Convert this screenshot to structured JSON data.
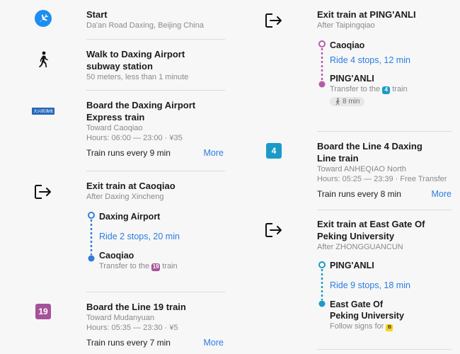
{
  "left": {
    "start": {
      "title": "Start",
      "address": "Da'an Road Daxing, Beijing China"
    },
    "walk": {
      "title_line1": "Walk to Daxing Airport",
      "title_line2": "subway station",
      "detail": "50 meters, less than 1 minute"
    },
    "board_express": {
      "badge_text": "大兴机场线",
      "title_line1": "Board the Daxing Airport",
      "title_line2": "Express train",
      "toward": "Toward Caoqiao",
      "hours": "Hours: 06:00 — 23:00 · ¥35",
      "frequency": "Train runs every 9 min",
      "more": "More"
    },
    "exit_caoqiao": {
      "title": "Exit train at Caoqiao",
      "after": "After Daxing Xincheng",
      "from_stop": "Daxing Airport",
      "ride": "Ride 2 stops, 20 min",
      "to_stop": "Caoqiao",
      "transfer_prefix": "Transfer to the",
      "transfer_badge": "19",
      "transfer_suffix": "train",
      "line_color": "#2e7fd6"
    },
    "board_19": {
      "badge_text": "19",
      "badge_color": "#a4539b",
      "title": "Board the Line 19 train",
      "toward": "Toward Mudanyuan",
      "hours": "Hours: 05:35 — 23:30 · ¥5",
      "frequency": "Train runs every 7 min",
      "more": "More"
    }
  },
  "right": {
    "exit_pinganli": {
      "title": "Exit train at PING'ANLI",
      "after": "After Taipingqiao",
      "from_stop": "Caoqiao",
      "ride": "Ride 4 stops, 12 min",
      "to_stop": "PING'ANLI",
      "transfer_prefix": "Transfer to the",
      "transfer_badge": "4",
      "transfer_suffix": "train",
      "walk_time": "8 min",
      "line_color": "#b65aa8"
    },
    "board_4": {
      "badge_text": "4",
      "badge_color": "#1a9bc7",
      "title_line1": "Board the Line 4 Daxing",
      "title_line2": "Line train",
      "toward": "Toward ANHEQIAO North",
      "hours": "Hours: 05:25 — 23:39 · Free Transfer",
      "frequency": "Train runs every 8 min",
      "more": "More"
    },
    "exit_east_gate": {
      "title_line1": "Exit train at East Gate Of",
      "title_line2": "Peking University",
      "after": "After ZHONGGUANCUN",
      "from_stop": "PING'ANLI",
      "ride": "Ride 9 stops, 18 min",
      "to_stop_line1": "East Gate Of",
      "to_stop_line2": "Peking University",
      "follow_prefix": "Follow signs for",
      "follow_badge": "B",
      "line_color": "#1a9bc7"
    }
  }
}
